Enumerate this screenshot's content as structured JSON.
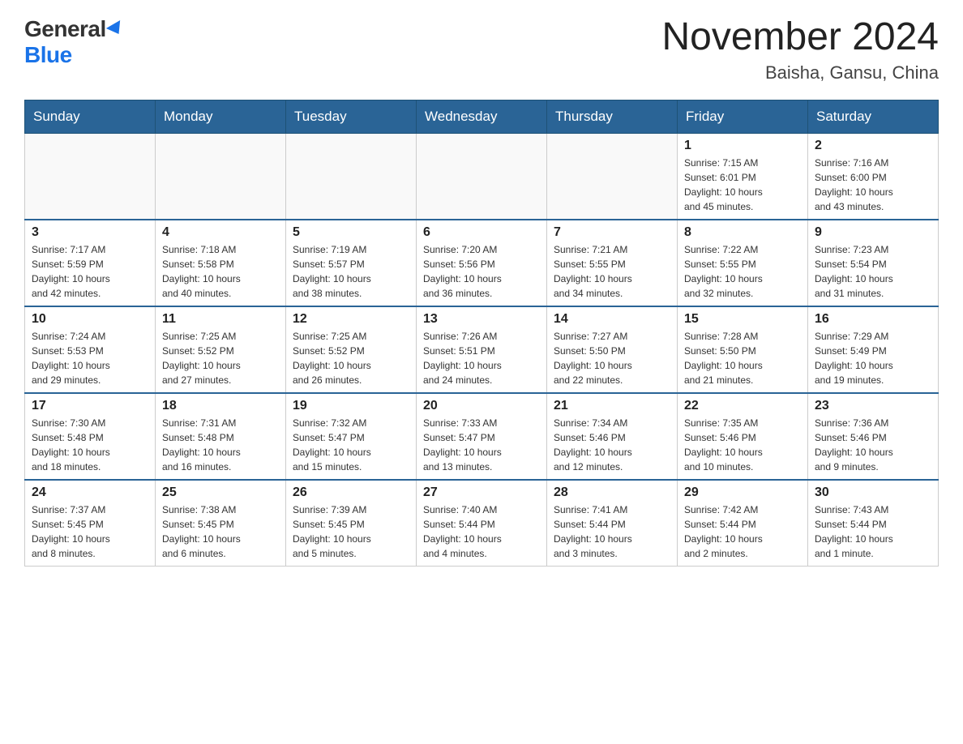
{
  "header": {
    "logo_general": "General",
    "logo_blue": "Blue",
    "title": "November 2024",
    "subtitle": "Baisha, Gansu, China"
  },
  "days_of_week": [
    "Sunday",
    "Monday",
    "Tuesday",
    "Wednesday",
    "Thursday",
    "Friday",
    "Saturday"
  ],
  "weeks": [
    [
      {
        "day": "",
        "info": ""
      },
      {
        "day": "",
        "info": ""
      },
      {
        "day": "",
        "info": ""
      },
      {
        "day": "",
        "info": ""
      },
      {
        "day": "",
        "info": ""
      },
      {
        "day": "1",
        "info": "Sunrise: 7:15 AM\nSunset: 6:01 PM\nDaylight: 10 hours\nand 45 minutes."
      },
      {
        "day": "2",
        "info": "Sunrise: 7:16 AM\nSunset: 6:00 PM\nDaylight: 10 hours\nand 43 minutes."
      }
    ],
    [
      {
        "day": "3",
        "info": "Sunrise: 7:17 AM\nSunset: 5:59 PM\nDaylight: 10 hours\nand 42 minutes."
      },
      {
        "day": "4",
        "info": "Sunrise: 7:18 AM\nSunset: 5:58 PM\nDaylight: 10 hours\nand 40 minutes."
      },
      {
        "day": "5",
        "info": "Sunrise: 7:19 AM\nSunset: 5:57 PM\nDaylight: 10 hours\nand 38 minutes."
      },
      {
        "day": "6",
        "info": "Sunrise: 7:20 AM\nSunset: 5:56 PM\nDaylight: 10 hours\nand 36 minutes."
      },
      {
        "day": "7",
        "info": "Sunrise: 7:21 AM\nSunset: 5:55 PM\nDaylight: 10 hours\nand 34 minutes."
      },
      {
        "day": "8",
        "info": "Sunrise: 7:22 AM\nSunset: 5:55 PM\nDaylight: 10 hours\nand 32 minutes."
      },
      {
        "day": "9",
        "info": "Sunrise: 7:23 AM\nSunset: 5:54 PM\nDaylight: 10 hours\nand 31 minutes."
      }
    ],
    [
      {
        "day": "10",
        "info": "Sunrise: 7:24 AM\nSunset: 5:53 PM\nDaylight: 10 hours\nand 29 minutes."
      },
      {
        "day": "11",
        "info": "Sunrise: 7:25 AM\nSunset: 5:52 PM\nDaylight: 10 hours\nand 27 minutes."
      },
      {
        "day": "12",
        "info": "Sunrise: 7:25 AM\nSunset: 5:52 PM\nDaylight: 10 hours\nand 26 minutes."
      },
      {
        "day": "13",
        "info": "Sunrise: 7:26 AM\nSunset: 5:51 PM\nDaylight: 10 hours\nand 24 minutes."
      },
      {
        "day": "14",
        "info": "Sunrise: 7:27 AM\nSunset: 5:50 PM\nDaylight: 10 hours\nand 22 minutes."
      },
      {
        "day": "15",
        "info": "Sunrise: 7:28 AM\nSunset: 5:50 PM\nDaylight: 10 hours\nand 21 minutes."
      },
      {
        "day": "16",
        "info": "Sunrise: 7:29 AM\nSunset: 5:49 PM\nDaylight: 10 hours\nand 19 minutes."
      }
    ],
    [
      {
        "day": "17",
        "info": "Sunrise: 7:30 AM\nSunset: 5:48 PM\nDaylight: 10 hours\nand 18 minutes."
      },
      {
        "day": "18",
        "info": "Sunrise: 7:31 AM\nSunset: 5:48 PM\nDaylight: 10 hours\nand 16 minutes."
      },
      {
        "day": "19",
        "info": "Sunrise: 7:32 AM\nSunset: 5:47 PM\nDaylight: 10 hours\nand 15 minutes."
      },
      {
        "day": "20",
        "info": "Sunrise: 7:33 AM\nSunset: 5:47 PM\nDaylight: 10 hours\nand 13 minutes."
      },
      {
        "day": "21",
        "info": "Sunrise: 7:34 AM\nSunset: 5:46 PM\nDaylight: 10 hours\nand 12 minutes."
      },
      {
        "day": "22",
        "info": "Sunrise: 7:35 AM\nSunset: 5:46 PM\nDaylight: 10 hours\nand 10 minutes."
      },
      {
        "day": "23",
        "info": "Sunrise: 7:36 AM\nSunset: 5:46 PM\nDaylight: 10 hours\nand 9 minutes."
      }
    ],
    [
      {
        "day": "24",
        "info": "Sunrise: 7:37 AM\nSunset: 5:45 PM\nDaylight: 10 hours\nand 8 minutes."
      },
      {
        "day": "25",
        "info": "Sunrise: 7:38 AM\nSunset: 5:45 PM\nDaylight: 10 hours\nand 6 minutes."
      },
      {
        "day": "26",
        "info": "Sunrise: 7:39 AM\nSunset: 5:45 PM\nDaylight: 10 hours\nand 5 minutes."
      },
      {
        "day": "27",
        "info": "Sunrise: 7:40 AM\nSunset: 5:44 PM\nDaylight: 10 hours\nand 4 minutes."
      },
      {
        "day": "28",
        "info": "Sunrise: 7:41 AM\nSunset: 5:44 PM\nDaylight: 10 hours\nand 3 minutes."
      },
      {
        "day": "29",
        "info": "Sunrise: 7:42 AM\nSunset: 5:44 PM\nDaylight: 10 hours\nand 2 minutes."
      },
      {
        "day": "30",
        "info": "Sunrise: 7:43 AM\nSunset: 5:44 PM\nDaylight: 10 hours\nand 1 minute."
      }
    ]
  ]
}
